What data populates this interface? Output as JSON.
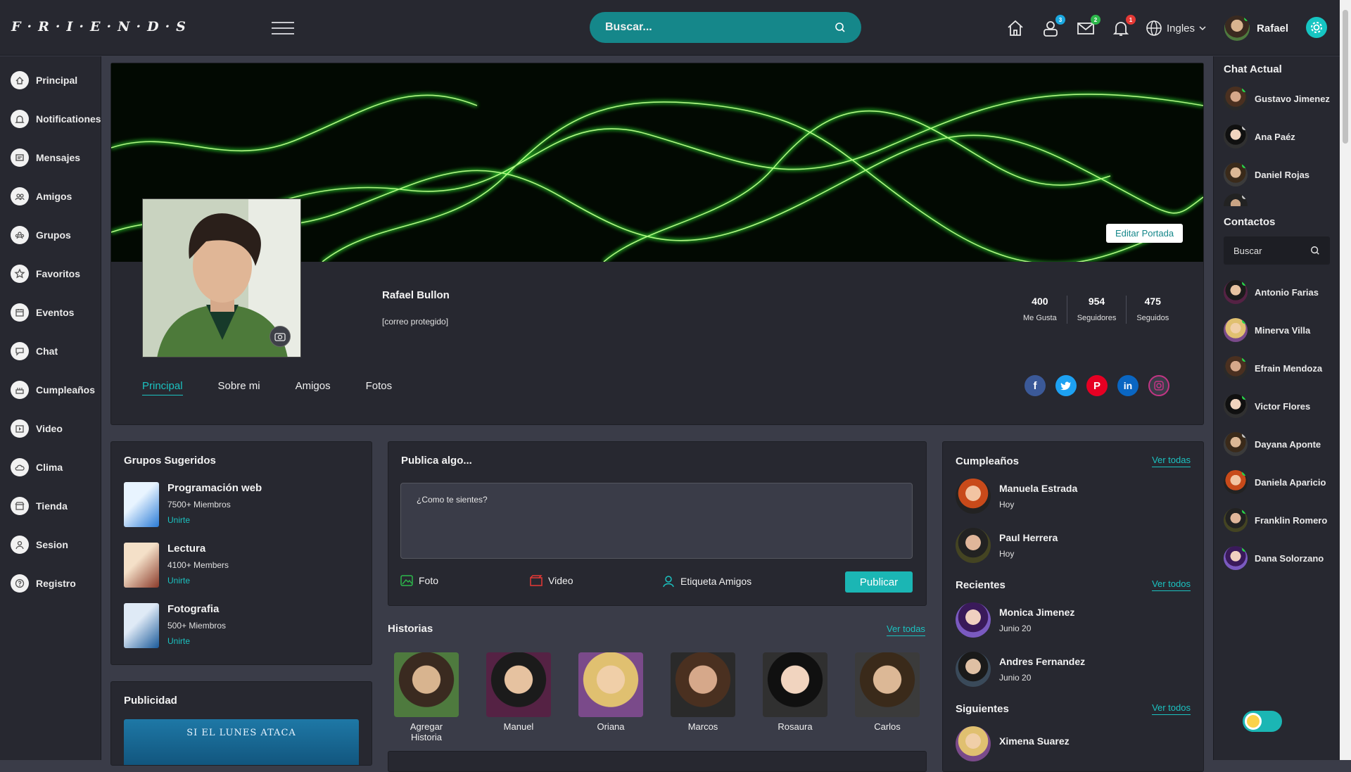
{
  "app": {
    "logo": "F·R·I·E·N·D·S"
  },
  "header": {
    "search_placeholder": "Buscar...",
    "badges": {
      "friends": "3",
      "messages": "2",
      "notifications": "1"
    },
    "language": "Ingles",
    "user_name": "Rafael"
  },
  "sidebar": {
    "items": [
      {
        "label": "Principal",
        "icon": "home-icon"
      },
      {
        "label": "Notificationes",
        "icon": "bell-icon"
      },
      {
        "label": "Mensajes",
        "icon": "message-icon"
      },
      {
        "label": "Amigos",
        "icon": "friends-icon"
      },
      {
        "label": "Grupos",
        "icon": "groups-icon"
      },
      {
        "label": "Favoritos",
        "icon": "star-icon"
      },
      {
        "label": "Eventos",
        "icon": "calendar-icon"
      },
      {
        "label": "Chat",
        "icon": "chat-icon"
      },
      {
        "label": "Cumpleaños",
        "icon": "cake-icon"
      },
      {
        "label": "Video",
        "icon": "video-icon"
      },
      {
        "label": "Clima",
        "icon": "weather-icon"
      },
      {
        "label": "Tienda",
        "icon": "store-icon"
      },
      {
        "label": "Sesion",
        "icon": "user-icon"
      },
      {
        "label": "Registro",
        "icon": "question-icon"
      }
    ]
  },
  "profile": {
    "edit_cover": "Editar Portada",
    "name": "Rafael Bullon",
    "email": "[correo protegido]",
    "stats": [
      {
        "value": "400",
        "label": "Me Gusta"
      },
      {
        "value": "954",
        "label": "Seguidores"
      },
      {
        "value": "475",
        "label": "Seguidos"
      }
    ],
    "tabs": [
      "Principal",
      "Sobre mi",
      "Amigos",
      "Fotos"
    ]
  },
  "groups": {
    "title": "Grupos Sugeridos",
    "items": [
      {
        "name": "Programación web",
        "members": "7500+ Miembros",
        "join": "Unirte"
      },
      {
        "name": "Lectura",
        "members": "4100+ Members",
        "join": "Unirte"
      },
      {
        "name": "Fotografia",
        "members": "500+ Miembros",
        "join": "Unirte"
      }
    ]
  },
  "ads": {
    "title": "Publicidad",
    "banner_text": "SI EL LUNES ATACA"
  },
  "post": {
    "title": "Publica algo...",
    "placeholder": "¿Como te sientes?",
    "photo": "Foto",
    "video": "Video",
    "tag": "Etiqueta Amigos",
    "publish": "Publicar"
  },
  "stories": {
    "title": "Historias",
    "see_all": "Ver todas",
    "items": [
      "Agregar Historia",
      "Manuel",
      "Oriana",
      "Marcos",
      "Rosaura",
      "Carlos"
    ]
  },
  "birthdays": {
    "title": "Cumpleaños",
    "see_all": "Ver todas",
    "items": [
      {
        "name": "Manuela Estrada",
        "date": "Hoy"
      },
      {
        "name": "Paul Herrera",
        "date": "Hoy"
      }
    ]
  },
  "recent": {
    "title": "Recientes",
    "see_all": "Ver todos",
    "items": [
      {
        "name": "Monica Jimenez",
        "date": "Junio 20"
      },
      {
        "name": "Andres Fernandez",
        "date": "Junio 20"
      }
    ]
  },
  "following": {
    "title": "Siguientes",
    "see_all": "Ver todos",
    "items": [
      {
        "name": "Ximena Suarez"
      }
    ]
  },
  "chat": {
    "title": "Chat Actual",
    "items": [
      "Gustavo Jimenez",
      "Ana Paéz",
      "Daniel Rojas"
    ]
  },
  "contacts": {
    "title": "Contactos",
    "search_placeholder": "Buscar",
    "items": [
      "Antonio Farias",
      "Minerva Villa",
      "Efrain Mendoza",
      "Victor Flores",
      "Dayana Aponte",
      "Daniela Aparicio",
      "Franklin Romero",
      "Dana Solorzano"
    ]
  },
  "colors": {
    "accent": "#1bc2c0",
    "search": "#15878a",
    "panel": "#272830",
    "bg": "#3a3c48"
  }
}
